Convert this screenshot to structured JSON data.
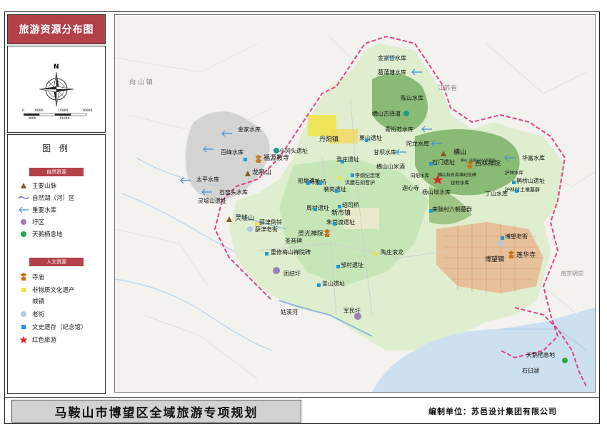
{
  "sidebar": {
    "title": "旅游资源分布图",
    "north_label": "N",
    "scale_ticks": [
      "0",
      "6000",
      "15000",
      "30000"
    ],
    "scale_sub": [
      "3000",
      "15000"
    ],
    "legend_title": "图 例",
    "natural_section": "自然资源",
    "natural_items": [
      "主要山脉",
      "自然湖（河）区",
      "重要水库",
      "圩区",
      "天鹅栖息地"
    ],
    "cultural_section": "人文资源",
    "cultural_items": [
      "寺庙",
      "非物质文化遗产",
      "城镇",
      "老街",
      "文史遗存（纪念馆）",
      "红色旅游"
    ]
  },
  "map": {
    "background_labels": [
      "向 山 镇",
      "江苏省",
      "南京明觉"
    ],
    "towns": [
      "丹阳镇",
      "新市镇",
      "博望镇"
    ],
    "mountains": [
      "龙泉山",
      "灵墟山",
      "横山"
    ],
    "reservoirs": [
      "金家岱水库",
      "葛蒲塘水库",
      "陈山水库",
      "青街范水库",
      "陀龙水库",
      "华富水库",
      "金家水库",
      "百峰水库",
      "甘坝水库",
      "太平水库",
      "石窑头水库",
      "向阳水库",
      "丁山水库",
      "杨山坳水库",
      "护林水库",
      "设村水库"
    ],
    "temples": [
      "福源教寺",
      "灵光禅院",
      "西林禅院",
      "莲华寺"
    ],
    "heritage_sites": [
      "小冈头遗址",
      "横山古驿道",
      "栗山遗址",
      "登庄遗址",
      "石门遗址",
      "横山（国家AAAA风景区）",
      "船墩遗址",
      "李纲纪念馆",
      "洪腊石刻音护",
      "叶家桥",
      "裴岗遗址",
      "横山山米酒",
      "横山抗日英雄纪念碑",
      "鹊桥山遗址",
      "护林村土墩墓群",
      "迦心寺",
      "周村遗址",
      "绍司桥",
      "朱岗渡遗址",
      "灵墟山遗址",
      "来陇村六朝墓群",
      "薛津倒铃",
      "薛津老街",
      "圣音碑",
      "重修梅山禅院碑",
      "陶庄滚龙",
      "团结圩",
      "邹村遗址",
      "釜山遗址",
      "姑溪河",
      "军民圩",
      "博望老街",
      "天鹅栖息地",
      "石臼湖"
    ]
  },
  "footer": {
    "title": "马鞍山市博望区全域旅游专项规划",
    "org": "编制单位：苏邑设计集团有限公司"
  },
  "colors": {
    "title_red": "#b2414a",
    "boundary_pink": "#e0408a",
    "temple_orange": "#c8761a",
    "heritage_blue": "#1a9ad6",
    "reservoir_blue": "#3f8fd8",
    "town_yellow": "#f2e23a",
    "park_green": "#2aa84a",
    "red_star": "#e02020",
    "water": "#cde0f0",
    "built_up": "#e7b890",
    "forest_green": "#7ab066",
    "farmland": "#d8eccc"
  }
}
